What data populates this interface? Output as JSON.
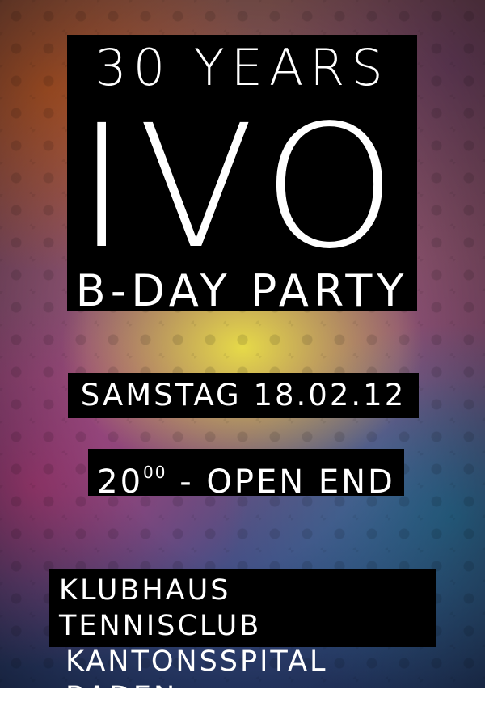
{
  "poster": {
    "title": {
      "line1": "30 YEARS",
      "name": "IVO",
      "line3": "B-DAY PARTY"
    },
    "date": "SAMSTAG 18.02.12",
    "time": {
      "start_hour": "20",
      "start_minutes": "00",
      "rest": " - OPEN END"
    },
    "venue": {
      "line1": "KLUBHAUS TENNISCLUB",
      "line2": "KANTONSSPITAL BADEN"
    },
    "colors": {
      "box": "#000000",
      "text": "#ffffff",
      "glow": "#ebe146"
    }
  }
}
